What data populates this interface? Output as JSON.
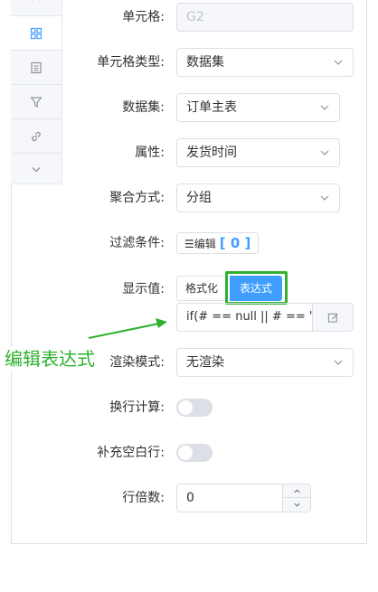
{
  "sidebar": {
    "items": [
      {
        "icon": "chevron-up-icon"
      },
      {
        "icon": "grid-icon",
        "active": true
      },
      {
        "icon": "list-icon"
      },
      {
        "icon": "filter-icon"
      },
      {
        "icon": "link-icon"
      },
      {
        "icon": "chevron-down-icon"
      }
    ]
  },
  "form": {
    "cell": {
      "label": "单元格:",
      "value": "G2"
    },
    "cell_type": {
      "label": "单元格类型:",
      "value": "数据集"
    },
    "dataset": {
      "label": "数据集:",
      "value": "订单主表"
    },
    "attribute": {
      "label": "属性:",
      "value": "发货时间"
    },
    "aggregate": {
      "label": "聚合方式:",
      "value": "分组"
    },
    "filter": {
      "label": "过滤条件:",
      "button": "☰编辑",
      "count": "[ 0 ]"
    },
    "display": {
      "label": "显示值:",
      "format_option": "格式化",
      "expression_option": "表达式",
      "selected": "表达式",
      "expression": "if(# == null || # == '') {"
    },
    "render_mode": {
      "label": "渲染模式:",
      "value": "无渲染"
    },
    "wrap_calc": {
      "label": "换行计算:",
      "enabled": false
    },
    "fill_blank": {
      "label": "补充空白行:",
      "enabled": false
    },
    "row_multiple": {
      "label": "行倍数:",
      "value": "0"
    }
  },
  "annotation": {
    "text": "编辑表达式",
    "color": "#2fb12f"
  },
  "colors": {
    "accent": "#409eff",
    "highlight": "#2fb12f"
  }
}
